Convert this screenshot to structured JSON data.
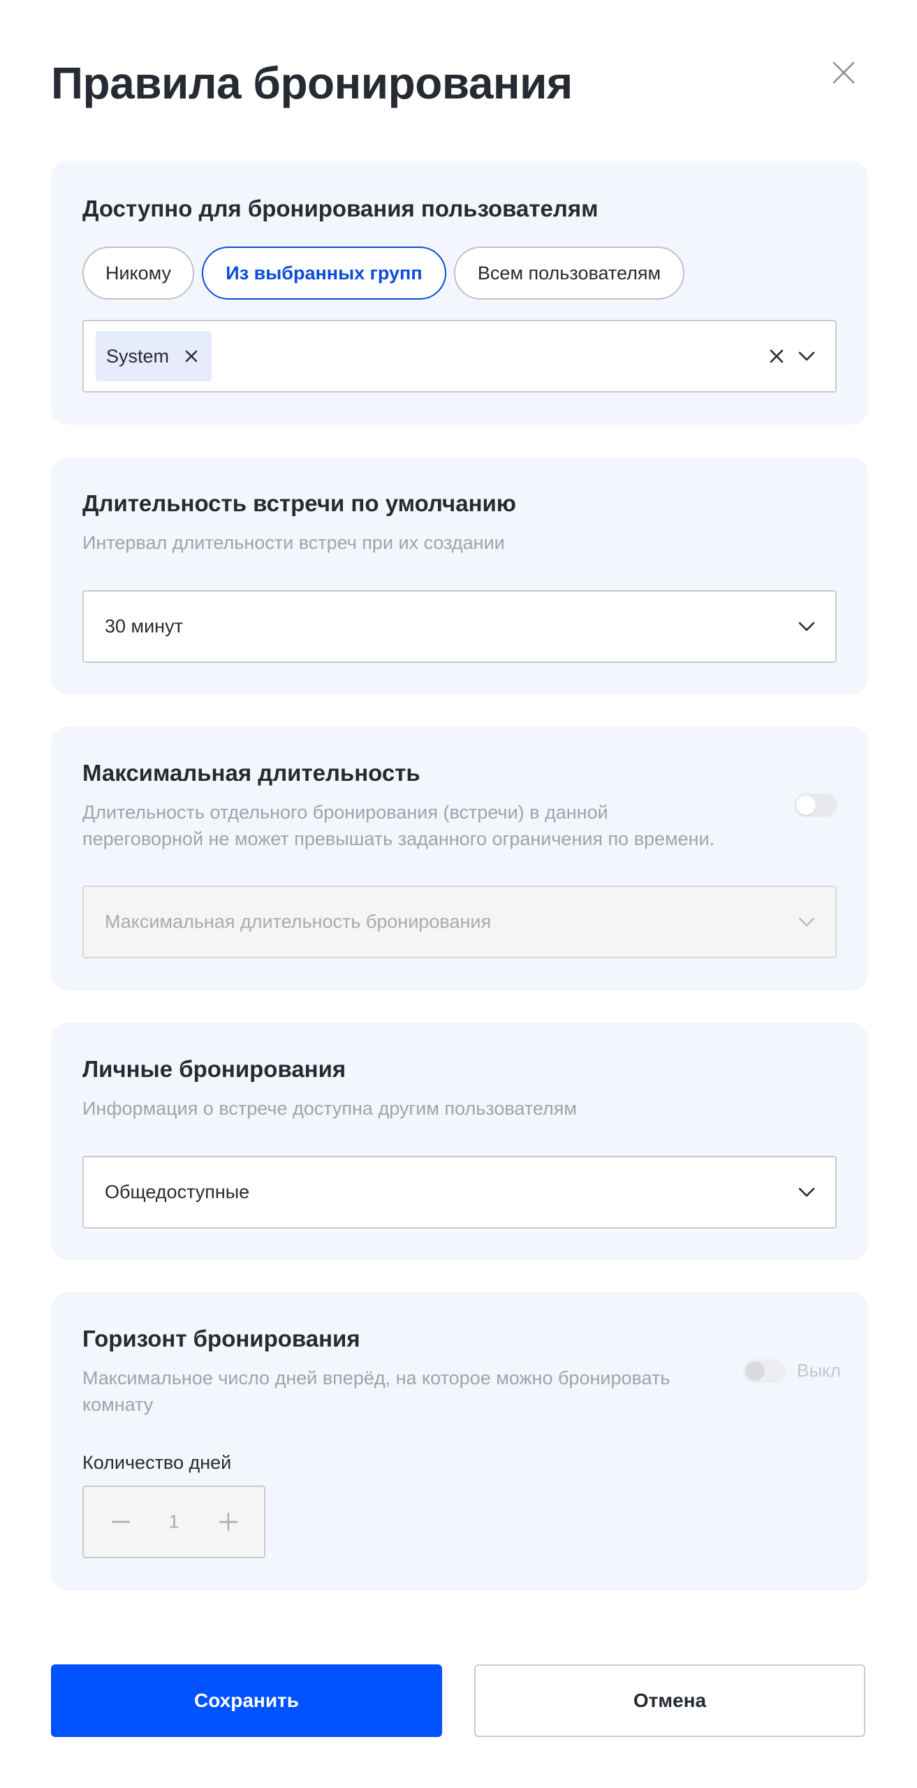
{
  "dialog": {
    "title": "Правила бронирования"
  },
  "access": {
    "title": "Доступно для бронирования пользователям",
    "options": [
      "Никому",
      "Из выбранных групп",
      "Всем пользователям"
    ],
    "selected_option": "Из выбранных групп",
    "groups": [
      "System"
    ]
  },
  "default_duration": {
    "title": "Длительность встречи по умолчанию",
    "description": "Интервал длительности встреч при их создании",
    "value": "30 минут"
  },
  "max_duration": {
    "title": "Максимальная длительность",
    "description_line1": "Длительность отдельного бронирования (встречи) в данной",
    "description_line2": "переговорной не может превышать заданного ограничения по времени.",
    "enabled": false,
    "placeholder": "Максимальная длительность бронирования"
  },
  "personal": {
    "title": "Личные бронирования",
    "description": "Информация о встрече доступна другим пользователям",
    "value": "Общедоступные"
  },
  "horizon": {
    "title": "Горизонт бронирования",
    "description_line1": "Максимальное число дней вперёд, на которое можно бронировать",
    "description_line2": "комнату",
    "toggle_label": "Выкл",
    "enabled": false,
    "days_label": "Количество дней",
    "days_value": "1"
  },
  "actions": {
    "save": "Сохранить",
    "cancel": "Отмена"
  },
  "colors": {
    "accent": "#0052ff",
    "card_bg": "#f4f6fd",
    "chip_bg": "#e6ecfb",
    "text": "#262b33",
    "muted": "#a0a3aa"
  },
  "icons": [
    "close-icon",
    "chip-remove-icon",
    "clear-icon",
    "chevron-down-icon",
    "minus-icon",
    "plus-icon"
  ]
}
